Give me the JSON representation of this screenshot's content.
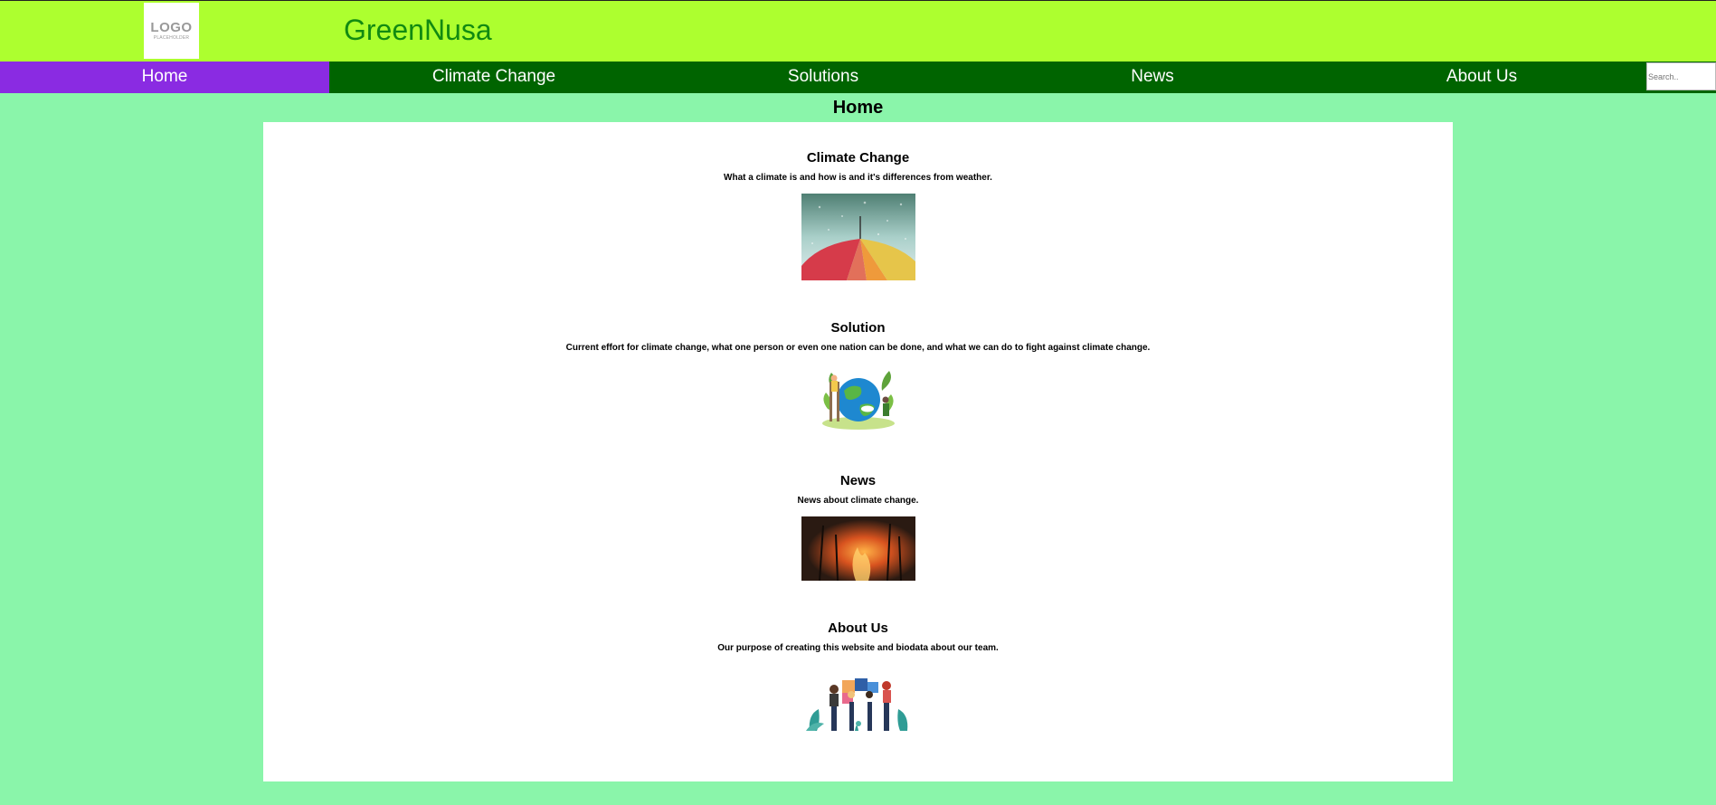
{
  "header": {
    "logo_line1": "LOGO",
    "logo_line2": "PLACEHOLDER",
    "site_title": "GreenNusa"
  },
  "nav": {
    "items": [
      "Home",
      "Climate Change",
      "Solutions",
      "News",
      "About Us"
    ],
    "active": "Home",
    "search_placeholder": "Search.."
  },
  "page": {
    "title": "Home"
  },
  "sections": [
    {
      "title": "Climate Change",
      "text": "What a climate is and how is and it's differences from weather.",
      "image": "rainbow-umbrella-in-rain"
    },
    {
      "title": "Solution",
      "text": "Current effort for climate change, what one person or even one nation can be done, and what we can do to fight against climate change.",
      "image": "people-caring-for-earth"
    },
    {
      "title": "News",
      "text": "News about climate change.",
      "image": "forest-fire"
    },
    {
      "title": "About Us",
      "text": "Our purpose of creating this website and biodata about our team.",
      "image": "team-with-puzzle-pieces"
    }
  ],
  "colors": {
    "header_bg": "#adff2f",
    "nav_bg": "#006400",
    "nav_active": "#8a2be2",
    "page_bg": "#8af5aa",
    "title": "#118a11"
  }
}
